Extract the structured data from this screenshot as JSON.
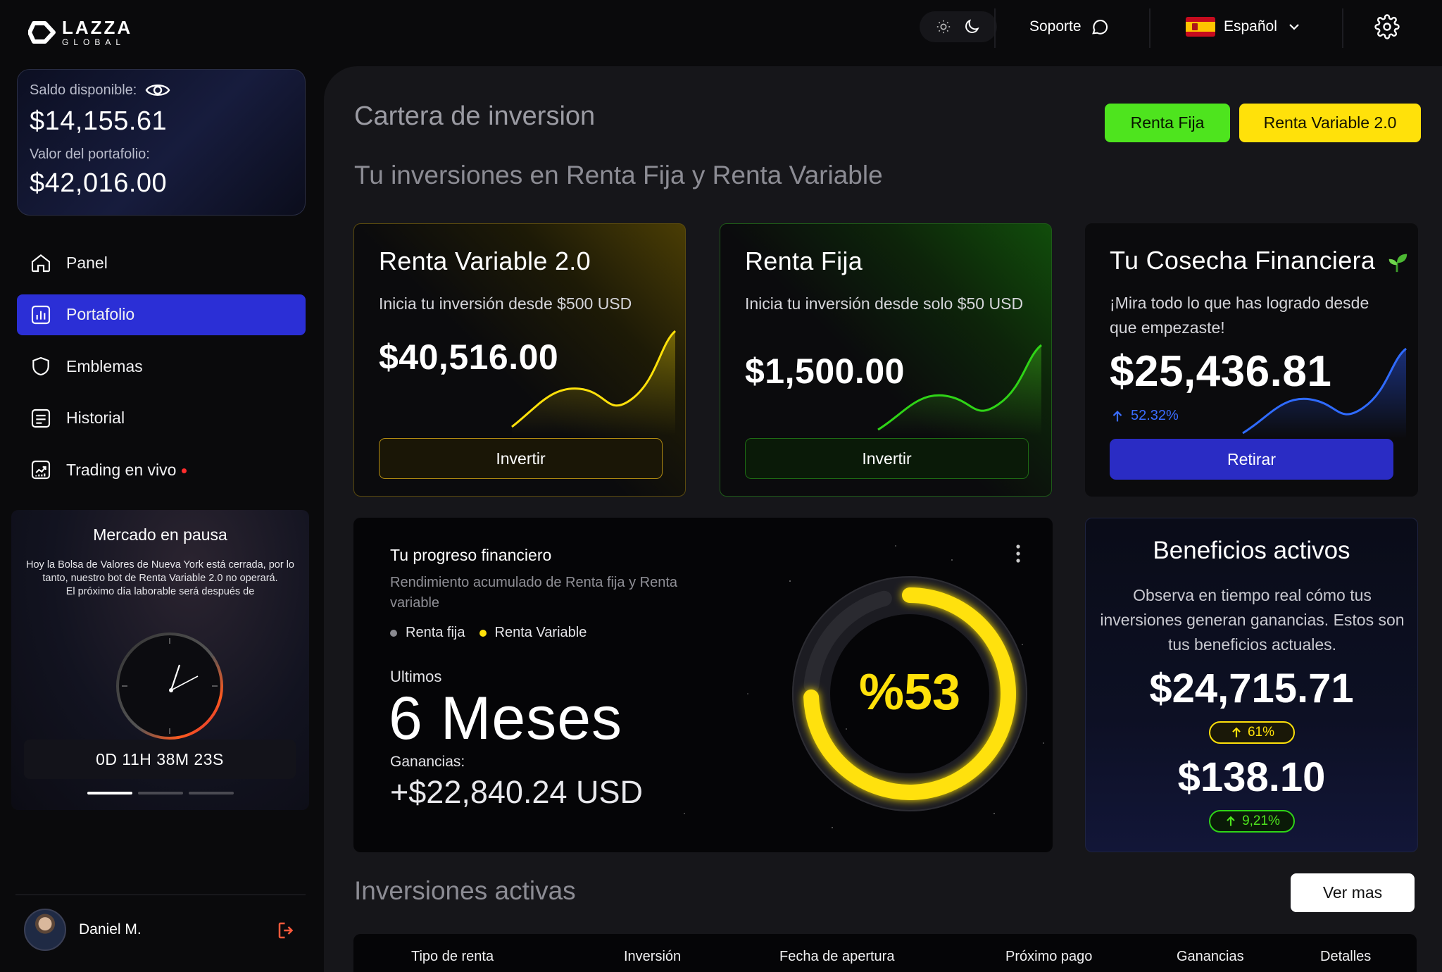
{
  "brand": {
    "line1": "LAZZA",
    "line2": "GLOBAL"
  },
  "topbar": {
    "support_label": "Soporte",
    "language_label": "Español"
  },
  "balance": {
    "available_label": "Saldo disponible:",
    "available_value": "$14,155.61",
    "portfolio_label": "Valor del portafolio:",
    "portfolio_value": "$42,016.00"
  },
  "nav": {
    "items": [
      {
        "label": "Panel",
        "icon": "home-icon"
      },
      {
        "label": "Portafolio",
        "icon": "portfolio-icon",
        "active": true
      },
      {
        "label": "Emblemas",
        "icon": "shield-icon"
      },
      {
        "label": "Historial",
        "icon": "history-icon"
      },
      {
        "label": "Trading en vivo",
        "icon": "trading-icon"
      }
    ]
  },
  "market": {
    "title": "Mercado en pausa",
    "message": "Hoy la Bolsa de Valores de Nueva York está cerrada, por lo tanto, nuestro bot de Renta Variable 2.0 no operará.",
    "next_day": "El próximo día laborable será después de",
    "countdown": "0D 11H 38M 23S"
  },
  "user": {
    "name": "Daniel M."
  },
  "page": {
    "title": "Cartera de inversion",
    "subtitle": "Tu inversiones en Renta Fija y Renta Variable",
    "btn_fixed": "Renta Fija",
    "btn_variable": "Renta Variable 2.0"
  },
  "cards": {
    "variable": {
      "title": "Renta Variable 2.0",
      "desc": "Inicia tu inversión desde $500 USD",
      "amount": "$40,516.00",
      "button": "Invertir",
      "color": "#ffe10a"
    },
    "fixed": {
      "title": "Renta Fija",
      "desc": "Inicia tu inversión desde solo $50 USD",
      "amount": "$1,500.00",
      "button": "Invertir",
      "color": "#4ee41e"
    },
    "harvest": {
      "title": "Tu Cosecha Financiera",
      "desc": "¡Mira todo lo que has logrado desde que empezaste!",
      "amount": "$25,436.81",
      "change": "52.32%",
      "button": "Retirar",
      "color": "#2b2fd6"
    }
  },
  "progress": {
    "title": "Tu progreso financiero",
    "subtitle": "Rendimiento acumulado de Renta fija y Renta variable",
    "legend": [
      "Renta fija",
      "Renta Variable"
    ],
    "period_label": "Ultimos",
    "period_value": "6 Meses",
    "earnings_label": "Ganancias:",
    "earnings_value": "+$22,840.24 USD",
    "percent_text": "%53",
    "percent": 53
  },
  "benefits": {
    "title": "Beneficios activos",
    "desc": "Observa en tiempo real cómo tus inversiones generan ganancias. Estos son tus beneficios actuales.",
    "amount1": "$24,715.71",
    "badge1": "61%",
    "amount2": "$138.10",
    "badge2": "9,21%"
  },
  "active_investments": {
    "title": "Inversiones activas",
    "more_button": "Ver mas",
    "columns": [
      "Tipo de renta",
      "Inversión",
      "Fecha de apertura",
      "Próximo pago",
      "Ganancias",
      "Detalles"
    ]
  }
}
